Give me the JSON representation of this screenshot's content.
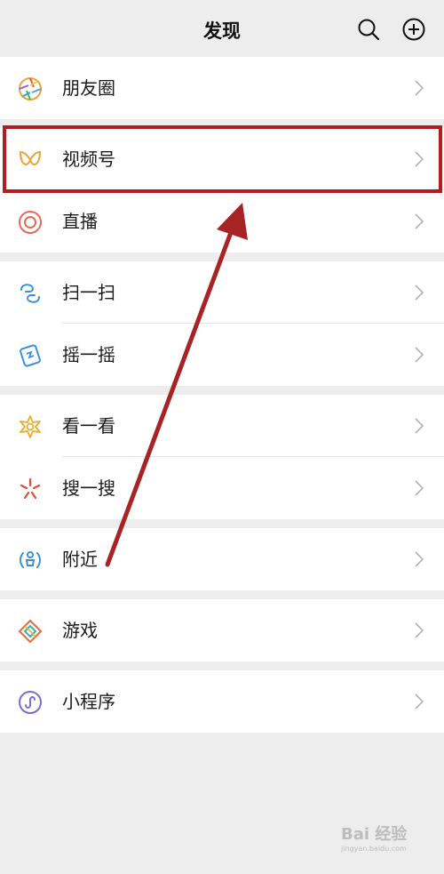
{
  "header": {
    "title": "发现"
  },
  "menu": {
    "moments": "朋友圈",
    "channels": "视频号",
    "live": "直播",
    "scan": "扫一扫",
    "shake": "摇一摇",
    "top_stories": "看一看",
    "search": "搜一搜",
    "nearby": "附近",
    "games": "游戏",
    "mini_programs": "小程序"
  },
  "watermark": {
    "text": "Bai 经验",
    "sub": "jingyan.baidu.com"
  },
  "colors": {
    "background": "#ededed",
    "row_bg": "#ffffff",
    "highlight": "#b51d1d",
    "arrow": "#a82424"
  }
}
